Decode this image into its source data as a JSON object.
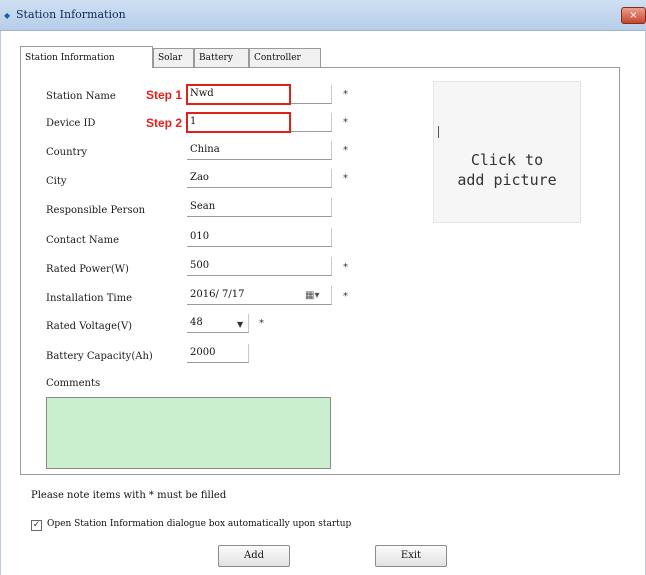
{
  "window": {
    "title": "Station Information",
    "icon": "app-icon",
    "close_label": "×"
  },
  "tabs": [
    {
      "label": "Station Information",
      "active": true
    },
    {
      "label": "Solar",
      "active": false
    },
    {
      "label": "Battery",
      "active": false
    },
    {
      "label": "Controller",
      "active": false
    }
  ],
  "form": {
    "station_name": {
      "label": "Station Name",
      "value": "Nwd",
      "required_mark": "*"
    },
    "device_id": {
      "label": "Device ID",
      "value": "1",
      "required_mark": "*"
    },
    "country": {
      "label": "Country",
      "value": "China",
      "required_mark": "*"
    },
    "city": {
      "label": "City",
      "value": "Zao",
      "required_mark": "*"
    },
    "responsible_person": {
      "label": "Responsible Person",
      "value": "Sean"
    },
    "contact_name": {
      "label": "Contact Name",
      "value": "010"
    },
    "rated_power": {
      "label": "Rated Power(W)",
      "value": "500",
      "required_mark": "*"
    },
    "installation_time": {
      "label": "Installation Time",
      "value": "2016/ 7/17",
      "required_mark": "*"
    },
    "rated_voltage": {
      "label": "Rated Voltage(V)",
      "value": "48",
      "required_mark": "*"
    },
    "battery_capacity": {
      "label": "Battery Capacity(Ah)",
      "value": "2000"
    },
    "comments": {
      "label": "Comments",
      "value": ""
    }
  },
  "annotations": {
    "step1": "Step 1",
    "step2": "Step 2",
    "color": "#e0201a"
  },
  "picture": {
    "placeholder_line1": "Click to",
    "placeholder_line2": "add picture"
  },
  "note": "Please note items with * must be filled",
  "startup_checkbox": {
    "checked": true,
    "label": "Open Station Information dialogue box automatically upon startup"
  },
  "buttons": {
    "add": "Add",
    "exit": "Exit"
  },
  "colors": {
    "comments_bg": "#c9efcf",
    "titlebar": "#cfe0f3"
  }
}
